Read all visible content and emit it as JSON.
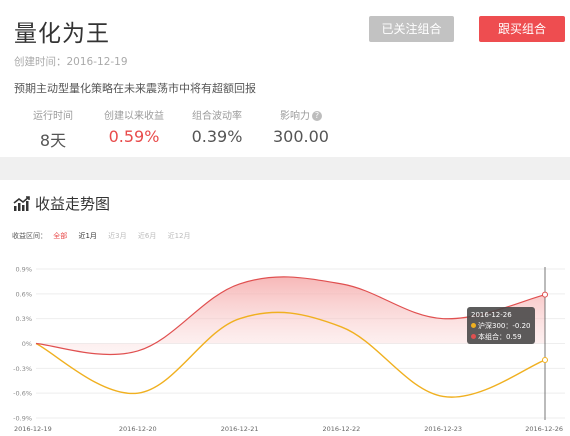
{
  "header": {
    "title": "量化为王",
    "created": "创建时间：2016-12-19",
    "description": "预期主动型量化策略在未来震荡市中将有超额回报",
    "followed_button": "已关注组合",
    "follow_button": "跟买组合"
  },
  "stats": [
    {
      "label": "运行时间",
      "value": "8天"
    },
    {
      "label": "创建以来收益",
      "value": "0.59%"
    },
    {
      "label": "组合波动率",
      "value": "0.39%"
    },
    {
      "label": "影响力",
      "value": "300.00"
    }
  ],
  "section": {
    "title": "收益走势图",
    "icon": "trend-chart-icon"
  },
  "range": {
    "label": "收益区间：",
    "options": [
      "全部",
      "近1月",
      "近3月",
      "近6月",
      "近12月"
    ]
  },
  "colors": {
    "accent_red": "#e84b4b",
    "series_portfolio": "#e05050",
    "series_hs300": "#f0b020",
    "button_grey": "#c2c2c2"
  },
  "chart_data": {
    "type": "line",
    "x": [
      "2016-12-19",
      "2016-12-20",
      "2016-12-21",
      "2016-12-22",
      "2016-12-23",
      "2016-12-26"
    ],
    "series": [
      {
        "name": "本组合",
        "values": [
          0,
          -0.09,
          0.72,
          0.72,
          0.3,
          0.59
        ]
      },
      {
        "name": "沪深300",
        "values": [
          0,
          -0.6,
          0.3,
          0.2,
          -0.64,
          -0.2
        ]
      }
    ],
    "yticks": [
      "0.9%",
      "0.6%",
      "0.3%",
      "0%",
      "-0.3%",
      "-0.6%",
      "-0.9%"
    ],
    "ylim": [
      -0.9,
      0.9
    ],
    "grid": true,
    "tooltip": {
      "date": "2016-12-26",
      "hs300": "沪深300：-0.20",
      "portfolio": "本组合：0.59"
    }
  }
}
